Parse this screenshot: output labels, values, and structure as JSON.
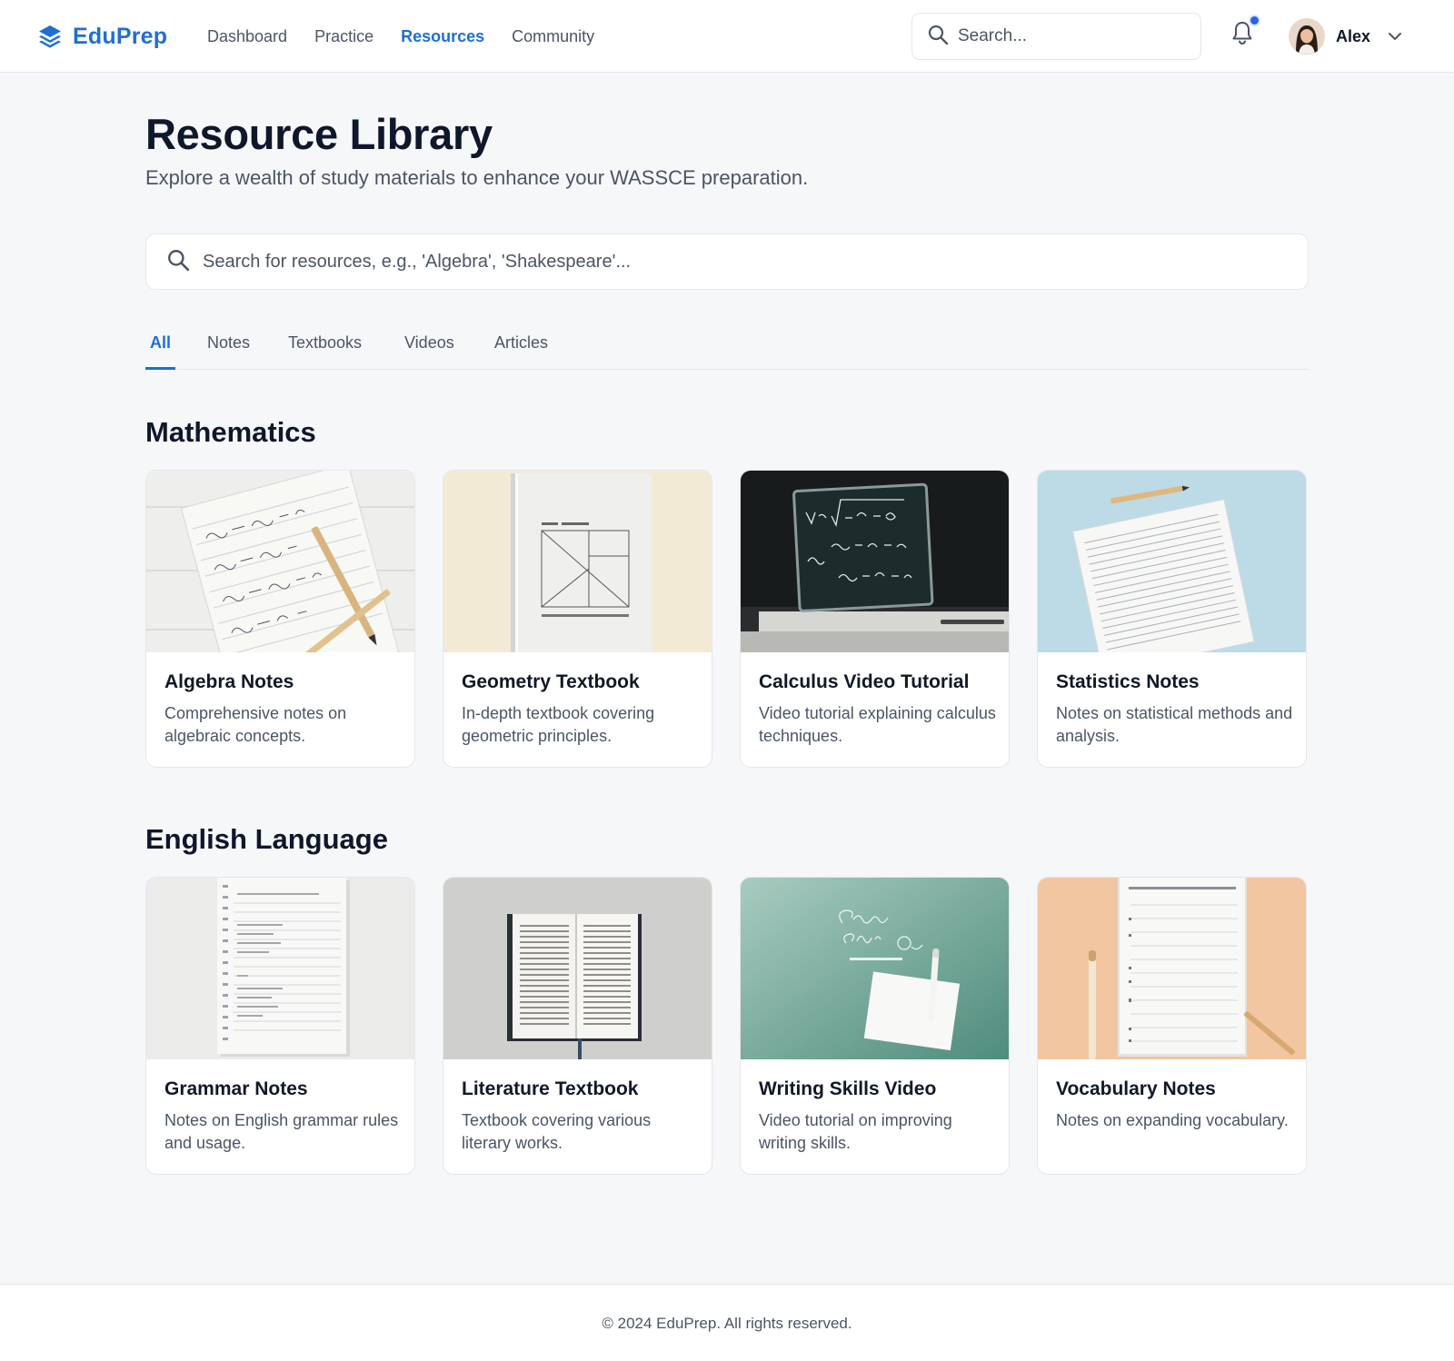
{
  "brand": {
    "name": "EduPrep",
    "color": "#1f6fd1",
    "logo_icon": "layers-icon"
  },
  "nav": {
    "items": [
      {
        "label": "Dashboard",
        "active": false
      },
      {
        "label": "Practice",
        "active": false
      },
      {
        "label": "Resources",
        "active": true
      },
      {
        "label": "Community",
        "active": false
      }
    ]
  },
  "header_search": {
    "placeholder": "Search...",
    "icon": "search-icon"
  },
  "notifications": {
    "icon": "bell-icon",
    "has_unread": true
  },
  "user": {
    "name": "Alex",
    "menu_icon": "chevron-down-icon"
  },
  "page": {
    "title": "Resource Library",
    "subtitle": "Explore a wealth of study materials to enhance your WASSCE preparation."
  },
  "resource_search": {
    "placeholder": "Search for resources, e.g., 'Algebra', 'Shakespeare'...",
    "icon": "search-icon"
  },
  "tabs": [
    {
      "label": "All",
      "active": true
    },
    {
      "label": "Notes",
      "active": false
    },
    {
      "label": "Textbooks",
      "active": false
    },
    {
      "label": "Videos",
      "active": false
    },
    {
      "label": "Articles",
      "active": false
    }
  ],
  "sections": [
    {
      "title": "Mathematics",
      "cards": [
        {
          "title": "Algebra Notes",
          "description": "Comprehensive notes on algebraic concepts."
        },
        {
          "title": "Geometry Textbook",
          "description": "In-depth textbook covering geometric principles."
        },
        {
          "title": "Calculus Video Tutorial",
          "description": "Video tutorial explaining calculus techniques."
        },
        {
          "title": "Statistics Notes",
          "description": "Notes on statistical methods and analysis."
        }
      ]
    },
    {
      "title": "English Language",
      "cards": [
        {
          "title": "Grammar Notes",
          "description": "Notes on English grammar rules and usage."
        },
        {
          "title": "Literature Textbook",
          "description": "Textbook covering various literary works."
        },
        {
          "title": "Writing Skills Video",
          "description": "Video tutorial on improving writing skills."
        },
        {
          "title": "Vocabulary Notes",
          "description": "Notes on expanding vocabulary."
        }
      ]
    }
  ],
  "footer": {
    "text": "© 2024 EduPrep. All rights reserved."
  }
}
